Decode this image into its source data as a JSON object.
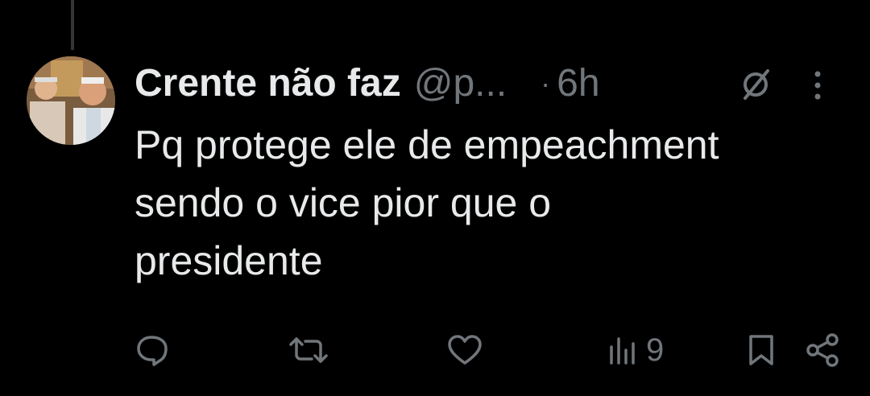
{
  "tweet": {
    "display_name": "Crente não faz",
    "handle": "@p...",
    "separator": "·",
    "time": "6h",
    "text": "Pq protege ele de empeachment\nsendo o vice pior que o\npresidente"
  },
  "icons": {
    "header": [
      "grok-icon",
      "more-icon"
    ],
    "actions": [
      "reply-icon",
      "retweet-icon",
      "like-icon",
      "views-icon",
      "bookmark-icon",
      "share-icon"
    ]
  },
  "actions": {
    "views_count": "9"
  },
  "colors": {
    "background": "#000000",
    "primary_text": "#e7e9ea",
    "secondary_text": "#71767b",
    "thread_line": "#333639"
  }
}
